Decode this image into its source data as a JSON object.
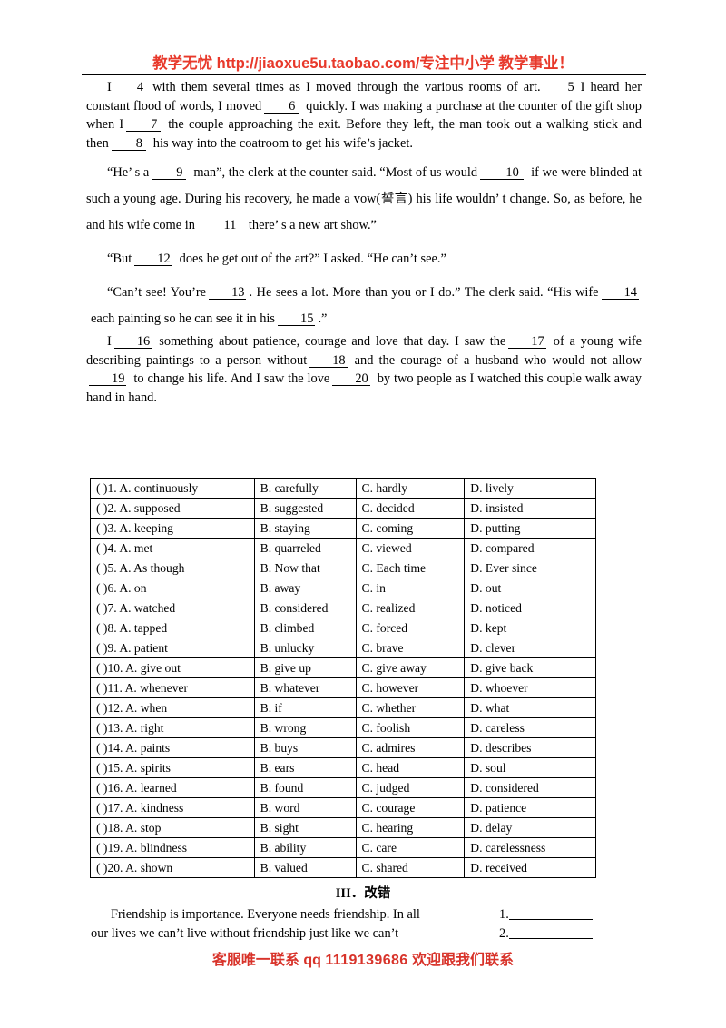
{
  "header": {
    "banner": "教学无忧 http://jiaoxue5u.taobao.com/专注中小学 教学事业！"
  },
  "passage": {
    "para1": {
      "seg1": "I",
      "blank1": "4",
      "seg2": "with them several times as I moved through the various rooms of art.",
      "blank2": "5",
      "seg3": "I heard her constant flood of words, I moved",
      "blank3": "6",
      "seg4": "quickly. I was making a purchase at the counter of the gift shop when I",
      "blank4": "7",
      "seg5": "the couple approaching the exit. Before they left, the man took out a walking stick and then",
      "blank5": "8",
      "seg6": "his way into the coatroom to get his wife’s jacket."
    },
    "para2": {
      "seg1": "“He’ s a",
      "blank1": "9",
      "seg2": "man”, the clerk at the counter said. “Most of us would",
      "blank2": "10",
      "seg3": "if we were blinded at such a young age. During his recovery, he made a vow(誓言) his life wouldn’ t change. So, as before, he and his wife come in",
      "blank3": "11",
      "seg4": "there’ s a new art show.”"
    },
    "para3": {
      "seg1": "“But",
      "blank1": "12",
      "seg2": "does he get out of the art?” I asked. “He can’t see.”"
    },
    "para4": {
      "seg1": "“Can’t see! You’re",
      "blank1": "13",
      "seg2": ". He sees a lot. More than you or I do.” The clerk said. “His wife",
      "blank2": "14",
      "seg3": "each painting so he can see it in his",
      "blank3": "15",
      "seg4": ".”"
    },
    "para5": {
      "seg1": "I",
      "blank1": "16",
      "seg2": "something about patience, courage and love that day. I saw the",
      "blank2": "17",
      "seg3": "of a young wife describing paintings to a person without",
      "blank3": "18",
      "seg4": "and the courage of a husband who would not allow",
      "blank4": "19",
      "seg5": "to change his life. And I saw the love",
      "blank5": "20",
      "seg6": "by two people as I watched this couple walk away hand in hand."
    }
  },
  "options_table": {
    "rows": [
      {
        "mark": "(    )",
        "num": "1.",
        "a": "A. continuously",
        "b": "B. carefully",
        "c": "C. hardly",
        "d": "D. lively"
      },
      {
        "mark": "(    )",
        "num": "2.",
        "a": "A. supposed",
        "b": "B. suggested",
        "c": "C. decided",
        "d": "D. insisted"
      },
      {
        "mark": "(    )",
        "num": "3.",
        "a": "A. keeping",
        "b": "B. staying",
        "c": "C. coming",
        "d": "D. putting"
      },
      {
        "mark": "(    )",
        "num": "4.",
        "a": "A. met",
        "b": "B. quarreled",
        "c": "C. viewed",
        "d": "D. compared"
      },
      {
        "mark": "(    )",
        "num": "5.",
        "a": "A. As though",
        "b": "B. Now that",
        "c": "C. Each time",
        "d": "D. Ever since"
      },
      {
        "mark": "(    )",
        "num": "6.",
        "a": "A. on",
        "b": "B. away",
        "c": "C. in",
        "d": "D. out"
      },
      {
        "mark": "(    )",
        "num": "7.",
        "a": "A. watched",
        "b": "B. considered",
        "c": "C. realized",
        "d": "D. noticed"
      },
      {
        "mark": "(    )",
        "num": "8.",
        "a": "A. tapped",
        "b": "B. climbed",
        "c": "C. forced",
        "d": "D. kept"
      },
      {
        "mark": "(    )",
        "num": "9.",
        "a": "A. patient",
        "b": "B. unlucky",
        "c": "C. brave",
        "d": "D. clever"
      },
      {
        "mark": "(    )",
        "num": "10.",
        "a": "A. give out",
        "b": "B. give up",
        "c": "C. give away",
        "d": "D. give back"
      },
      {
        "mark": "(    )",
        "num": "11.",
        "a": "A. whenever",
        "b": "B. whatever",
        "c": "C. however",
        "d": "D. whoever"
      },
      {
        "mark": "(    )",
        "num": "12.",
        "a": "A. when",
        "b": "B. if",
        "c": "C. whether",
        "d": "D. what"
      },
      {
        "mark": "(    )",
        "num": "13.",
        "a": "A. right",
        "b": "B. wrong",
        "c": "C. foolish",
        "d": "D. careless"
      },
      {
        "mark": "(    )",
        "num": "14.",
        "a": "A. paints",
        "b": "B. buys",
        "c": "C. admires",
        "d": "D. describes"
      },
      {
        "mark": "(    )",
        "num": "15.",
        "a": "A. spirits",
        "b": "B. ears",
        "c": "C. head",
        "d": "D. soul"
      },
      {
        "mark": "(    )",
        "num": "16.",
        "a": "A. learned",
        "b": "B. found",
        "c": "C. judged",
        "d": "D. considered"
      },
      {
        "mark": "(    )",
        "num": "17.",
        "a": "A. kindness",
        "b": "B. word",
        "c": "C. courage",
        "d": "D. patience"
      },
      {
        "mark": "(    )",
        "num": "18.",
        "a": "A. stop",
        "b": "B. sight",
        "c": "C. hearing",
        "d": "D. delay"
      },
      {
        "mark": "(    )",
        "num": "19.",
        "a": "A. blindness",
        "b": "B. ability",
        "c": "C. care",
        "d": "D. carelessness"
      },
      {
        "mark": "(    )",
        "num": "20.",
        "a": "A. shown",
        "b": "B. valued",
        "c": "C. shared",
        "d": "D. received"
      }
    ]
  },
  "section3": {
    "title": "III．改错",
    "line1_text": "Friendship is importance. Everyone needs friendship. In all",
    "line1_num": "1.",
    "line2_text": "our lives we can’t live without friendship just like we can’t",
    "line2_num": "2."
  },
  "footer": {
    "prefix": "客服唯一联系 qq",
    "qq": "1119139686",
    "suffix": "欢迎跟我们联系"
  },
  "colors": {
    "banner_red": "#e8392b",
    "footer_red": "#d8332a",
    "text_black": "#000000"
  }
}
